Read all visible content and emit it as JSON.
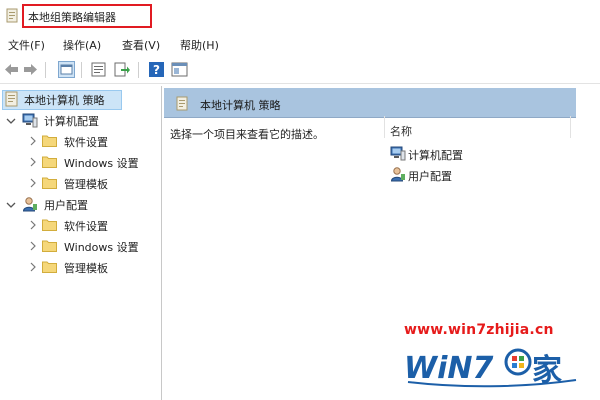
{
  "window": {
    "title": "本地组策略编辑器"
  },
  "menu": [
    "文件(F)",
    "操作(A)",
    "查看(V)",
    "帮助(H)"
  ],
  "toolbar": {
    "buttons": [
      "back-icon",
      "forward-icon",
      "show-tree-icon",
      "properties-icon",
      "export-icon",
      "help-icon",
      "view-icon"
    ]
  },
  "tree": {
    "root": "本地计算机 策略",
    "computer": {
      "label": "计算机配置",
      "children": [
        "软件设置",
        "Windows 设置",
        "管理模板"
      ]
    },
    "user": {
      "label": "用户配置",
      "children": [
        "软件设置",
        "Windows 设置",
        "管理模板"
      ]
    }
  },
  "right_pane": {
    "header": "本地计算机 策略",
    "description": "选择一个项目来查看它的描述。",
    "column_name": "名称",
    "items": [
      "计算机配置",
      "用户配置"
    ]
  },
  "watermark": {
    "url": "www.win7zhijia.cn",
    "logo_text": "WiN7",
    "logo_char": "家"
  },
  "colors": {
    "title_highlight": "#e11b22",
    "selection": "#cce4f7",
    "header_bg": "#a9c4df",
    "watermark_red": "#e61b1b",
    "logo_blue": "#1c5fa8"
  }
}
